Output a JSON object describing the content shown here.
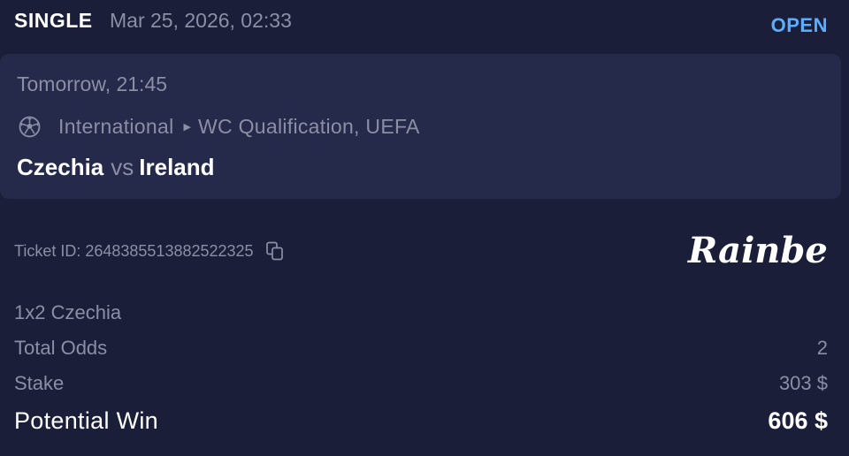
{
  "header": {
    "bet_type": "SINGLE",
    "date": "Mar 25, 2026, 02:33",
    "status": "OPEN",
    "status_color": "#5aaeff"
  },
  "event": {
    "time": "Tomorrow, 21:45",
    "sport_icon": "soccer-ball-icon",
    "category": "International",
    "separator_icon": "caret-right-icon",
    "league": "WC Qualification, UEFA",
    "home_team": "Czechia",
    "vs_label": "vs",
    "away_team": "Ireland"
  },
  "ticket": {
    "label": "Ticket ID:",
    "id": "2648385513882522325",
    "copy_icon": "copy-icon"
  },
  "brand": {
    "name": "Rainbet"
  },
  "details": {
    "selection": "1x2 Czechia",
    "total_odds_label": "Total Odds",
    "total_odds_value": "2",
    "stake_label": "Stake",
    "stake_value": "303 $",
    "potential_win_label": "Potential Win",
    "potential_win_value": "606 $"
  },
  "colors": {
    "background": "#1a1e38",
    "card": "#252a4b",
    "muted_text": "#8b8fa6",
    "accent": "#5aaeff"
  }
}
